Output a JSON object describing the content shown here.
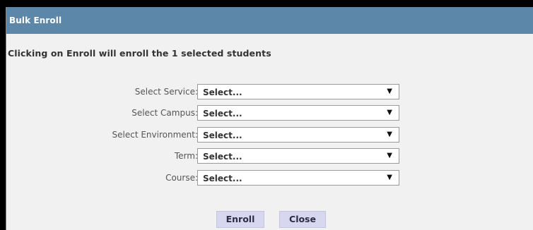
{
  "dialog": {
    "title": "Bulk Enroll",
    "message": "Clicking on Enroll will enroll the 1 selected students"
  },
  "fields": [
    {
      "label": "Select Service:",
      "value": "Select..."
    },
    {
      "label": "Select Campus:",
      "value": "Select..."
    },
    {
      "label": "Select Environment:",
      "value": "Select..."
    },
    {
      "label": "Term:",
      "value": "Select..."
    },
    {
      "label": "Course:",
      "value": "Select..."
    }
  ],
  "icons": {
    "dropdown_caret": "▼"
  },
  "buttons": {
    "enroll": "Enroll",
    "close": "Close"
  },
  "colors": {
    "titlebar": "#5d87a8",
    "dialog_bg": "#f1f1f1",
    "button_bg": "#d7d8ef"
  }
}
